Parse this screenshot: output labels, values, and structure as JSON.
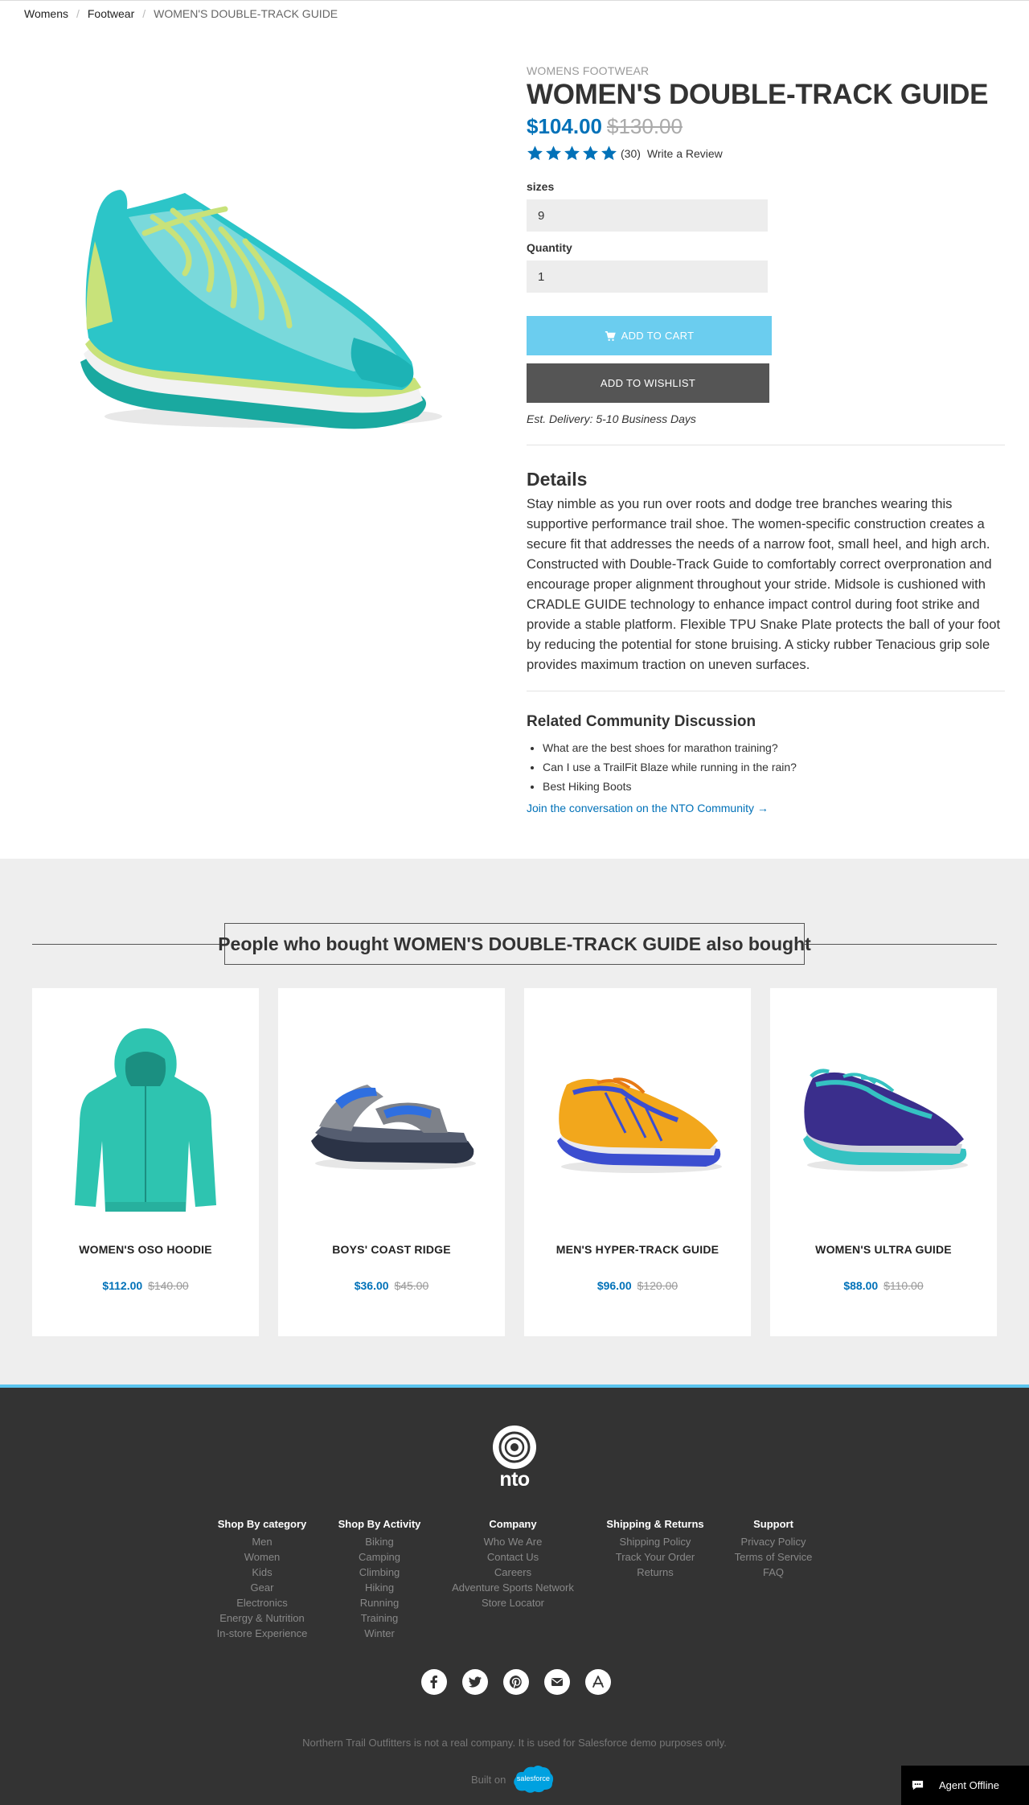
{
  "breadcrumb": [
    "Womens",
    "Footwear",
    "WOMEN'S DOUBLE-TRACK GUIDE"
  ],
  "product": {
    "category": "WOMENS FOOTWEAR",
    "title": "WOMEN'S DOUBLE-TRACK GUIDE",
    "price_sale": "$104.00",
    "price_original": "$130.00",
    "rating_stars": 5,
    "review_count": "(30)",
    "write_review": "Write a Review",
    "sizes_label": "sizes",
    "sizes_value": "9",
    "quantity_label": "Quantity",
    "quantity_value": "1",
    "add_to_cart": "ADD TO CART",
    "add_to_wishlist": "ADD TO WISHLIST",
    "delivery": "Est. Delivery: 5-10 Business Days",
    "details_heading": "Details",
    "details_text": "Stay nimble as you run over roots and dodge tree branches wearing this supportive performance trail shoe. The women-specific construction creates a secure fit that addresses the needs of a narrow foot, small heel, and high arch. Constructed with Double-Track Guide to comfortably correct overpronation and encourage proper alignment throughout your stride. Midsole is cushioned with CRADLE GUIDE technology to enhance impact control during foot strike and provide a stable platform. Flexible TPU Snake Plate protects the ball of your foot by reducing the potential for stone bruising. A sticky rubber Tenacious grip sole provides maximum traction on uneven surfaces."
  },
  "community": {
    "heading": "Related Community Discussion",
    "items": [
      "What are the best shoes for marathon training?",
      "Can I use a TrailFit Blaze while running in the rain?",
      "Best Hiking Boots"
    ],
    "link": "Join the conversation on the NTO Community →"
  },
  "also_bought": {
    "heading": "People who bought WOMEN'S DOUBLE-TRACK GUIDE also bought",
    "products": [
      {
        "name": "WOMEN'S OSO HOODIE",
        "sale": "$112.00",
        "original": "$140.00"
      },
      {
        "name": "BOYS' COAST RIDGE",
        "sale": "$36.00",
        "original": "$45.00"
      },
      {
        "name": "MEN'S HYPER-TRACK GUIDE",
        "sale": "$96.00",
        "original": "$120.00"
      },
      {
        "name": "WOMEN'S ULTRA GUIDE",
        "sale": "$88.00",
        "original": "$110.00"
      }
    ]
  },
  "footer": {
    "logo_text": "nto",
    "columns": [
      {
        "title": "Shop By category",
        "links": [
          "Men",
          "Women",
          "Kids",
          "Gear",
          "Electronics",
          "Energy & Nutrition",
          "In-store Experience"
        ]
      },
      {
        "title": "Shop By Activity",
        "links": [
          "Biking",
          "Camping",
          "Climbing",
          "Hiking",
          "Running",
          "Training",
          "Winter"
        ]
      },
      {
        "title": "Company",
        "links": [
          "Who We Are",
          "Contact Us",
          "Careers",
          "Adventure Sports Network",
          "Store Locator"
        ]
      },
      {
        "title": "Shipping & Returns",
        "links": [
          "Shipping Policy",
          "Track Your Order",
          "Returns"
        ]
      },
      {
        "title": "Support",
        "links": [
          "Privacy Policy",
          "Terms of Service",
          "FAQ"
        ]
      }
    ],
    "social_icons": [
      "facebook-icon",
      "twitter-icon",
      "pinterest-icon",
      "email-icon",
      "app-store-icon"
    ],
    "disclaimer": "Northern Trail Outfitters is not a real company. It is used for Salesforce demo purposes only.",
    "built_on": "Built on",
    "salesforce_label": "salesforce"
  },
  "chat": {
    "label": "Agent Offline"
  },
  "colors": {
    "accent_blue": "#0071b8",
    "cart_button": "#6bcdef",
    "footer_bg": "#333333",
    "footer_accent": "#5bc4ee"
  }
}
